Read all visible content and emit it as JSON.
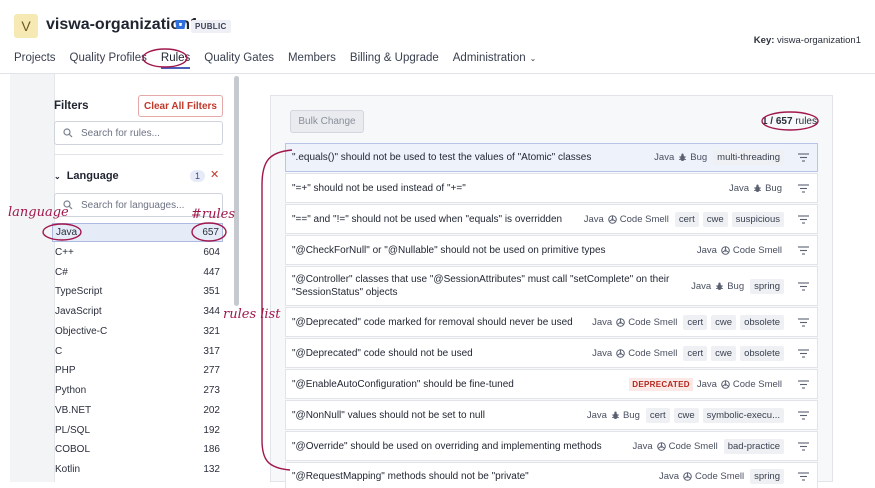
{
  "header": {
    "avatar_letter": "V",
    "org_name": "viswa-organization1",
    "visibility_badge": "PUBLIC",
    "key_label": "Key:",
    "key_value": "viswa-organization1"
  },
  "nav": {
    "items": [
      {
        "label": "Projects"
      },
      {
        "label": "Quality Profiles"
      },
      {
        "label": "Rules",
        "active": true
      },
      {
        "label": "Quality Gates"
      },
      {
        "label": "Members"
      },
      {
        "label": "Billing & Upgrade"
      },
      {
        "label": "Administration",
        "dropdown": true
      }
    ]
  },
  "filters": {
    "title": "Filters",
    "clear_all": "Clear All Filters",
    "search_placeholder": "Search for rules...",
    "language": {
      "label": "Language",
      "selected_count": "1",
      "search_placeholder": "Search for languages...",
      "items": [
        {
          "name": "Java",
          "count": "657",
          "selected": true
        },
        {
          "name": "C++",
          "count": "604"
        },
        {
          "name": "C#",
          "count": "447"
        },
        {
          "name": "TypeScript",
          "count": "351"
        },
        {
          "name": "JavaScript",
          "count": "344"
        },
        {
          "name": "Objective-C",
          "count": "321"
        },
        {
          "name": "C",
          "count": "317"
        },
        {
          "name": "PHP",
          "count": "277"
        },
        {
          "name": "Python",
          "count": "273"
        },
        {
          "name": "VB.NET",
          "count": "202"
        },
        {
          "name": "PL/SQL",
          "count": "192"
        },
        {
          "name": "COBOL",
          "count": "186"
        },
        {
          "name": "Kotlin",
          "count": "132"
        }
      ]
    }
  },
  "rules": {
    "bulk_change": "Bulk Change",
    "count_current": "1 / 657",
    "count_suffix": "rules",
    "items": [
      {
        "title": "\".equals()\" should not be used to test the values of \"Atomic\" classes",
        "lang": "Java",
        "type": "Bug",
        "tags": [
          "multi-threading"
        ],
        "selected": true
      },
      {
        "title": "\"=+\" should not be used instead of \"+=\"",
        "lang": "Java",
        "type": "Bug",
        "tags": []
      },
      {
        "title": "\"==\" and \"!=\" should not be used when \"equals\" is overridden",
        "lang": "Java",
        "type": "Code Smell",
        "tags": [
          "cert",
          "cwe",
          "suspicious"
        ]
      },
      {
        "title": "\"@CheckForNull\" or \"@Nullable\" should not be used on primitive types",
        "lang": "Java",
        "type": "Code Smell",
        "tags": []
      },
      {
        "title": "\"@Controller\" classes that use \"@SessionAttributes\" must call \"setComplete\" on their \"SessionStatus\" objects",
        "lang": "Java",
        "type": "Bug",
        "tags": [
          "spring"
        ]
      },
      {
        "title": "\"@Deprecated\" code marked for removal should never be used",
        "lang": "Java",
        "type": "Code Smell",
        "tags": [
          "cert",
          "cwe",
          "obsolete"
        ]
      },
      {
        "title": "\"@Deprecated\" code should not be used",
        "lang": "Java",
        "type": "Code Smell",
        "tags": [
          "cert",
          "cwe",
          "obsolete"
        ]
      },
      {
        "title": "\"@EnableAutoConfiguration\" should be fine-tuned",
        "lang": "Java",
        "type": "Code Smell",
        "tags": [],
        "deprecated": "DEPRECATED"
      },
      {
        "title": "\"@NonNull\" values should not be set to null",
        "lang": "Java",
        "type": "Bug",
        "tags": [
          "cert",
          "cwe",
          "symbolic-execu..."
        ]
      },
      {
        "title": "\"@Override\" should be used on overriding and implementing methods",
        "lang": "Java",
        "type": "Code Smell",
        "tags": [
          "bad-practice"
        ]
      },
      {
        "title": "\"@RequestMapping\" methods should not be \"private\"",
        "lang": "Java",
        "type": "Code Smell",
        "tags": [
          "spring"
        ]
      }
    ]
  },
  "annotations": {
    "language": "language",
    "rules_count": "#rules",
    "rules_list": "rules list",
    "color": "#a0174b"
  }
}
